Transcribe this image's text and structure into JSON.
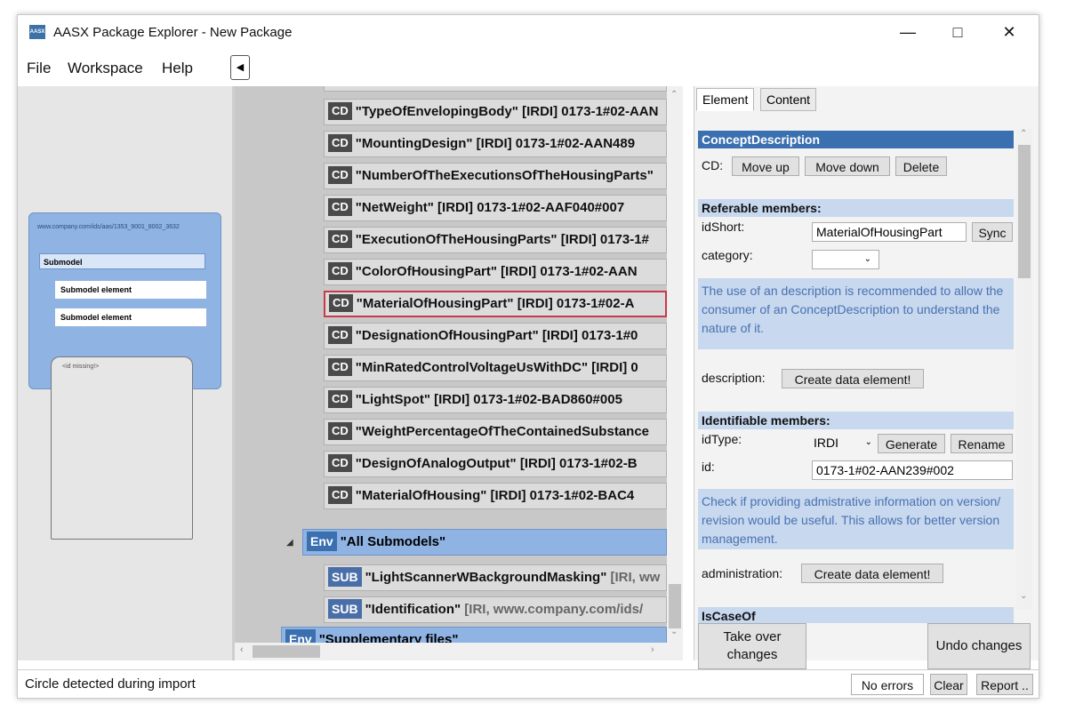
{
  "window": {
    "title": "AASX Package Explorer - New Package",
    "icon_text": "AASX"
  },
  "menu": {
    "items": [
      "File",
      "Workspace",
      "Help"
    ]
  },
  "left_panel": {
    "url": "www.company.com/ids/aas/1353_9001_8002_3632",
    "submodel": "Submodel",
    "elements": [
      "Submodel element",
      "Submodel element"
    ],
    "id_missing": "<id missing!>"
  },
  "tree": {
    "cd_tag": "CD",
    "env_tag": "Env",
    "sub_tag": "SUB",
    "cds": [
      "\"TypeOfEnvelopingBody\" [IRDI] 0173-1#02-AAN",
      "\"MountingDesign\" [IRDI] 0173-1#02-AAN489",
      "\"NumberOfTheExecutionsOfTheHousingParts\"",
      "\"NetWeight\" [IRDI] 0173-1#02-AAF040#007",
      "\"ExecutionOfTheHousingParts\" [IRDI] 0173-1#",
      "\"ColorOfHousingPart\" [IRDI] 0173-1#02-AAN",
      "\"MaterialOfHousingPart\" [IRDI] 0173-1#02-A",
      "\"DesignationOfHousingPart\" [IRDI] 0173-1#0",
      "\"MinRatedControlVoltageUsWithDC\" [IRDI] 0",
      "\"LightSpot\" [IRDI] 0173-1#02-BAD860#005",
      "\"WeightPercentageOfTheContainedSubstance",
      "\"DesignOfAnalogOutput\" [IRDI] 0173-1#02-B",
      "\"MaterialOfHousing\" [IRDI] 0173-1#02-BAC4"
    ],
    "env_submodels": "\"All Submodels\"",
    "subs": [
      {
        "name": "\"LightScannerWBackgroundMasking\"",
        "rest": "[IRI, ww"
      },
      {
        "name": "\"Identification\"",
        "rest": "[IRI, www.company.com/ids/"
      }
    ],
    "env_files": "\"Supplementary files\""
  },
  "editor": {
    "tabs": [
      "Element",
      "Content"
    ],
    "concept_header": "ConceptDescription",
    "cd_label": "CD:",
    "move_up": "Move up",
    "move_down": "Move down",
    "delete": "Delete",
    "referable_header": "Referable members:",
    "idshort_label": "idShort:",
    "idshort_value": "MaterialOfHousingPart",
    "sync": "Sync",
    "category_label": "category:",
    "category_value": "",
    "hint_description": "The use of an description is recommended to allow the consumer of an ConceptDescription to understand the nature of it.",
    "description_label": "description:",
    "create_data_element": "Create data element!",
    "identifiable_header": "Identifiable members:",
    "idtype_label": "idType:",
    "idtype_value": "IRDI",
    "generate": "Generate",
    "rename": "Rename",
    "id_label": "id:",
    "id_value": "0173-1#02-AAN239#002",
    "hint_admin": "Check if providing admistrative information on version/ revision would be useful. This allows for better version management.",
    "administration_label": "administration:",
    "iscaseof_header": "IsCaseOf",
    "take_over": "Take over changes",
    "undo": "Undo changes"
  },
  "status": {
    "message": "Circle detected during import",
    "errors": "No errors",
    "clear": "Clear",
    "report": "Report .."
  }
}
